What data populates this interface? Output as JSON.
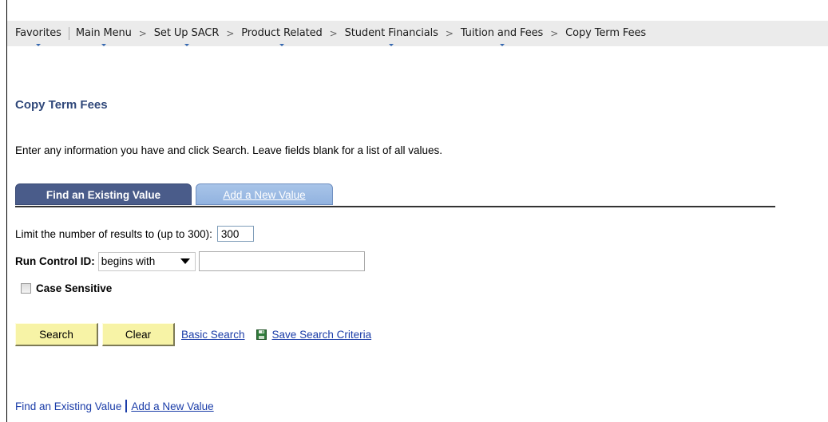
{
  "breadcrumb": {
    "items": [
      {
        "label": "Favorites"
      },
      {
        "label": "Main Menu"
      },
      {
        "label": "Set Up SACR"
      },
      {
        "label": "Product Related"
      },
      {
        "label": "Student Financials"
      },
      {
        "label": "Tuition and Fees"
      },
      {
        "label": "Copy Term Fees"
      }
    ],
    "separator": ">"
  },
  "page": {
    "title": "Copy Term Fees",
    "instructions": "Enter any information you have and click Search. Leave fields blank for a list of all values."
  },
  "tabs": {
    "find_label": "Find an Existing Value",
    "add_label": "Add a New Value"
  },
  "form": {
    "limit_label": "Limit the number of results to (up to 300):",
    "limit_value": "300",
    "run_control_label": "Run Control ID:",
    "operator_value": "begins with",
    "run_control_value": "",
    "case_sensitive_label": "Case Sensitive",
    "case_sensitive_checked": false
  },
  "actions": {
    "search_label": "Search",
    "clear_label": "Clear",
    "basic_search_label": "Basic Search",
    "save_criteria_label": "Save Search Criteria",
    "save_icon": "save-icon"
  },
  "footer": {
    "find_label": "Find an Existing Value",
    "add_label": "Add a New Value"
  },
  "colors": {
    "title": "#30487a",
    "active_tab": "#4a5c8a",
    "inactive_tab": "#9bb9e4",
    "button": "#f7f3a6",
    "link": "#1a3ca8",
    "breadcrumb_bg": "#ebebeb"
  }
}
